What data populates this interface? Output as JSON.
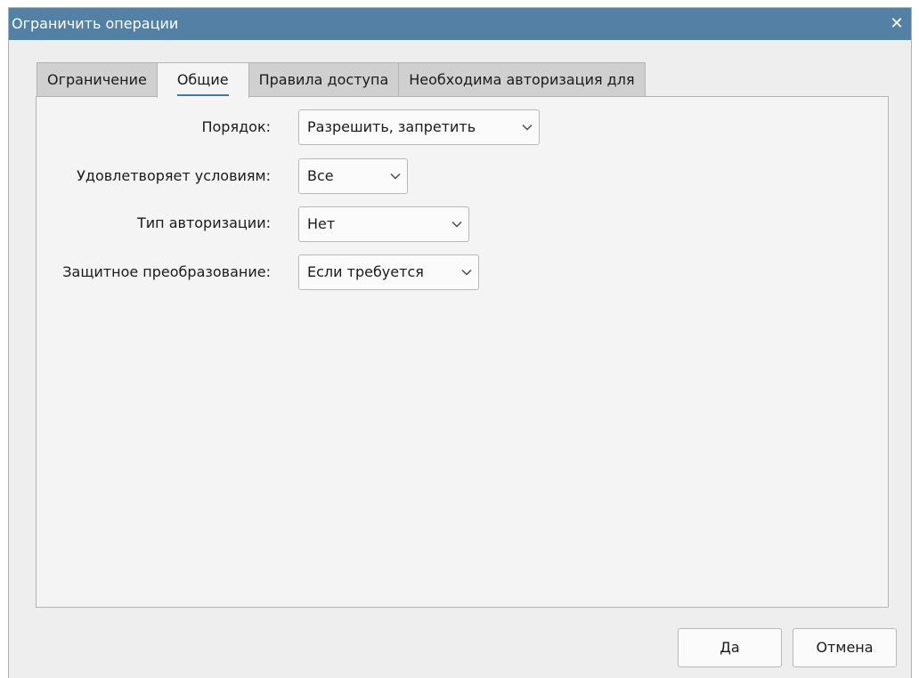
{
  "window": {
    "title": "Ограничить операции",
    "close_glyph": "✕",
    "accent_color": "#5381a5"
  },
  "tabs": [
    {
      "label": "Ограничение",
      "active": false
    },
    {
      "label": "Общие",
      "active": true
    },
    {
      "label": "Правила доступа",
      "active": false
    },
    {
      "label": "Необходима авторизация для",
      "active": false
    }
  ],
  "form": {
    "order": {
      "label": "Порядок:",
      "value": "Разрешить, запретить"
    },
    "satisfy": {
      "label": "Удовлетворяет условиям:",
      "value": "Все"
    },
    "auth_type": {
      "label": "Тип авторизации:",
      "value": "Нет"
    },
    "encryption": {
      "label": "Защитное преобразование:",
      "value": "Если требуется"
    }
  },
  "buttons": {
    "ok_label": "Да",
    "cancel_label": "Отмена"
  },
  "icons": {
    "close": "close-icon",
    "dropdown": "chevron-down-icon"
  }
}
